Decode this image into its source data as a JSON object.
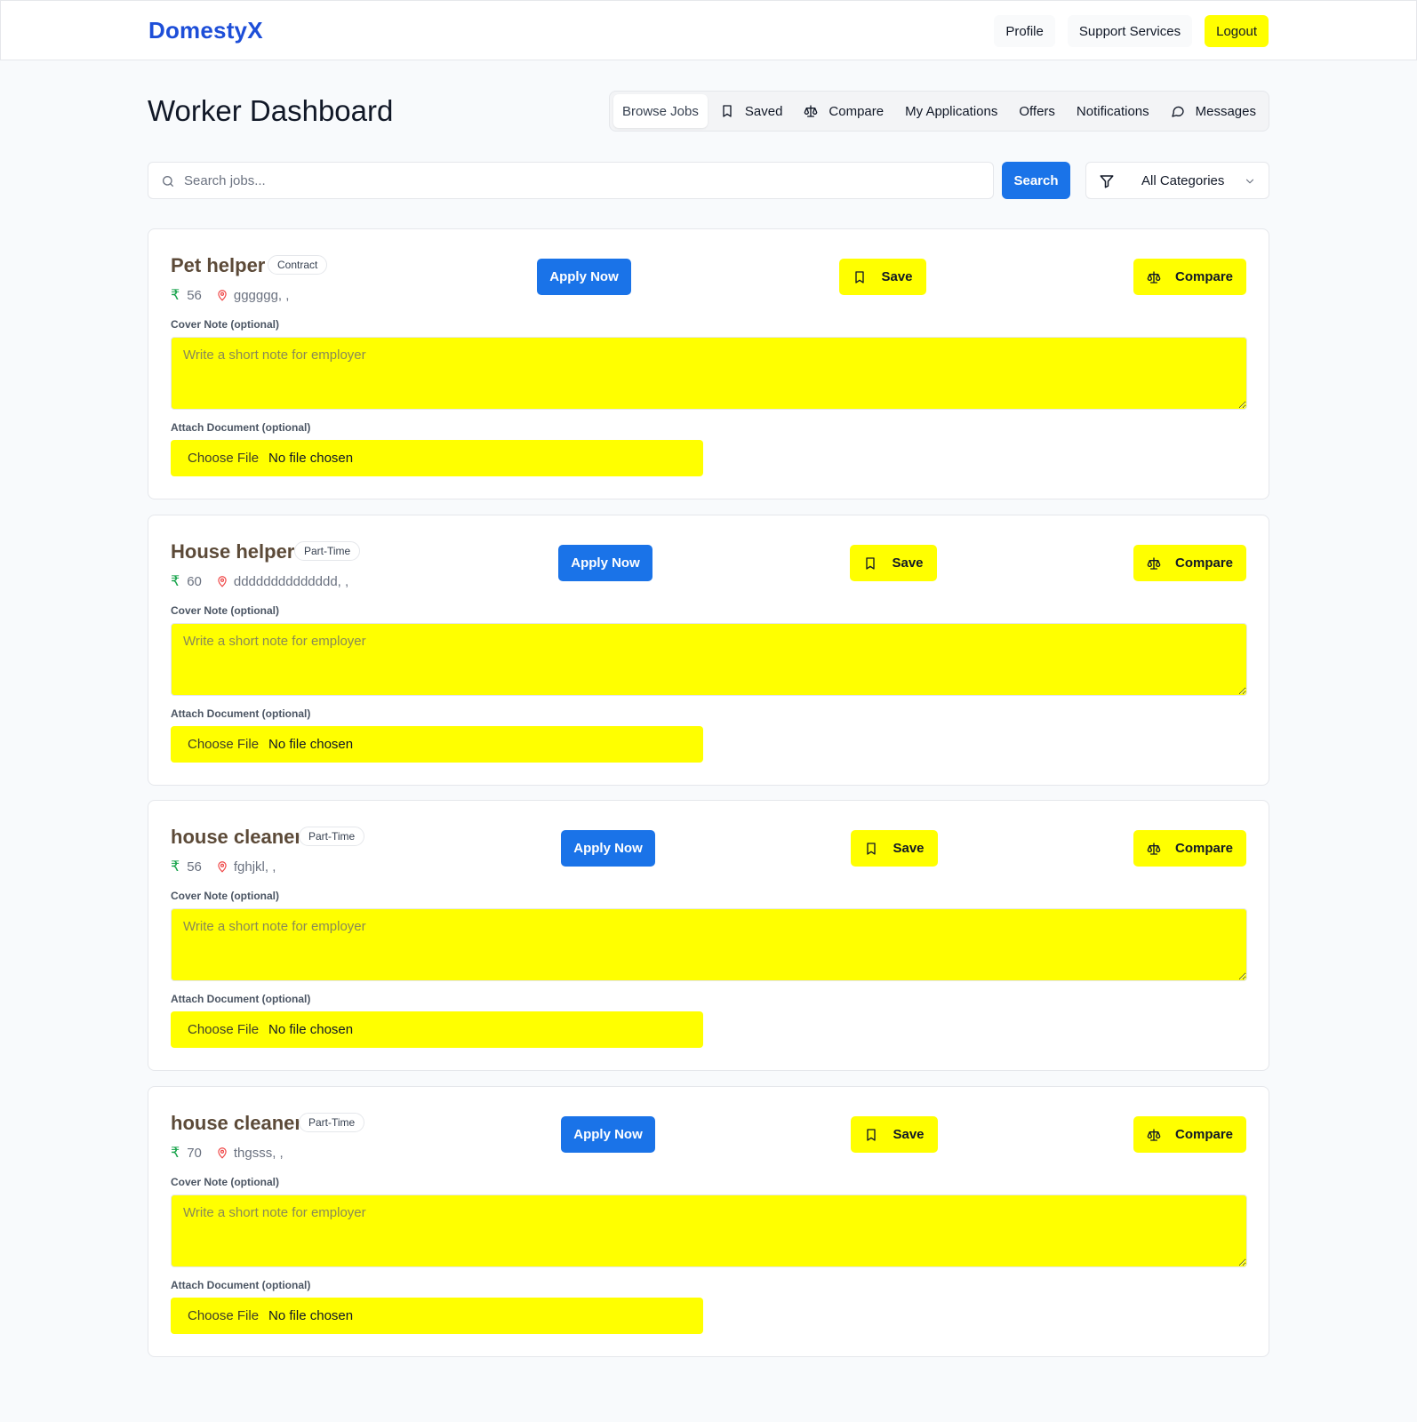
{
  "header": {
    "brand": "DomestyX",
    "nav": {
      "profile": "Profile",
      "support": "Support Services",
      "logout": "Logout"
    }
  },
  "page": {
    "title": "Worker Dashboard"
  },
  "tabs": [
    {
      "label": "Browse Jobs",
      "icon": ""
    },
    {
      "label": "Saved",
      "icon": "bookmark-icon"
    },
    {
      "label": "Compare",
      "icon": "scale-icon"
    },
    {
      "label": "My Applications",
      "icon": ""
    },
    {
      "label": "Offers",
      "icon": ""
    },
    {
      "label": "Notifications",
      "icon": ""
    },
    {
      "label": "Messages",
      "icon": "message-icon"
    }
  ],
  "search": {
    "placeholder": "Search jobs...",
    "value": "",
    "button": "Search",
    "category": "All Categories"
  },
  "labels": {
    "apply": "Apply Now",
    "save": "Save",
    "compare": "Compare",
    "cover_note": "Cover Note (optional)",
    "cover_placeholder": "Write a short note for employer",
    "attach": "Attach Document (optional)",
    "choose_file": "Choose File",
    "no_file": "No file chosen",
    "currency": "₹"
  },
  "colors": {
    "brand": "#1d4ed8",
    "primary": "#1a73e8",
    "highlight": "#ffff00",
    "title_brown": "#5c4a38",
    "rupee_green": "#16a34a",
    "pin_red": "#ef4444"
  },
  "jobs": [
    {
      "title": "Pet helper",
      "type": "Contract",
      "pay": "56",
      "location": "gggggg, ,"
    },
    {
      "title": "House helper",
      "type": "Part-Time",
      "pay": "60",
      "location": "dddddddddddddd, ,"
    },
    {
      "title": "house cleaner",
      "type": "Part-Time",
      "pay": "56",
      "location": "fghjkl, ,"
    },
    {
      "title": "house cleaner",
      "type": "Part-Time",
      "pay": "70",
      "location": "thgsss, ,"
    }
  ]
}
